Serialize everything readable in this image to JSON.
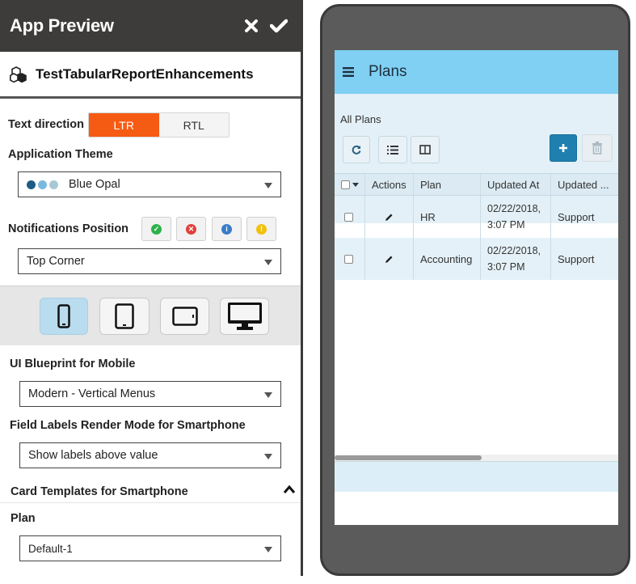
{
  "panel": {
    "title": "App Preview",
    "app_name": "TestTabularReportEnhancements"
  },
  "text_direction": {
    "label": "Text direction",
    "options": [
      "LTR",
      "RTL"
    ],
    "selected": "LTR"
  },
  "theme": {
    "label": "Application Theme",
    "value": "Blue Opal",
    "swatches": [
      "#1c5c85",
      "#7ab8df",
      "#a9c8d6"
    ]
  },
  "notifications": {
    "label": "Notifications Position",
    "value": "Top Corner"
  },
  "blueprint": {
    "label": "UI Blueprint for Mobile",
    "value": "Modern - Vertical Menus"
  },
  "field_labels": {
    "label": "Field Labels Render Mode for Smartphone",
    "value": "Show labels above value"
  },
  "card_templates": {
    "label": "Card Templates for Smartphone",
    "plan_label": "Plan",
    "plan_value": "Default-1"
  },
  "colors": {
    "accent": "#f65b14",
    "topbar": "#7fd0f2",
    "primary": "#1f80b0"
  },
  "preview": {
    "page_title": "Plans",
    "section_title": "All Plans",
    "columns": [
      "Actions",
      "Plan",
      "Updated At",
      "Updated ..."
    ],
    "rows": [
      {
        "plan": "HR",
        "updated_at_1": "02/22/2018,",
        "updated_at_2": "3:07 PM",
        "updated_by": "Support"
      },
      {
        "plan": "Accounting",
        "updated_at_1": "02/22/2018,",
        "updated_at_2": "3:07 PM",
        "updated_by": "Support"
      }
    ]
  }
}
